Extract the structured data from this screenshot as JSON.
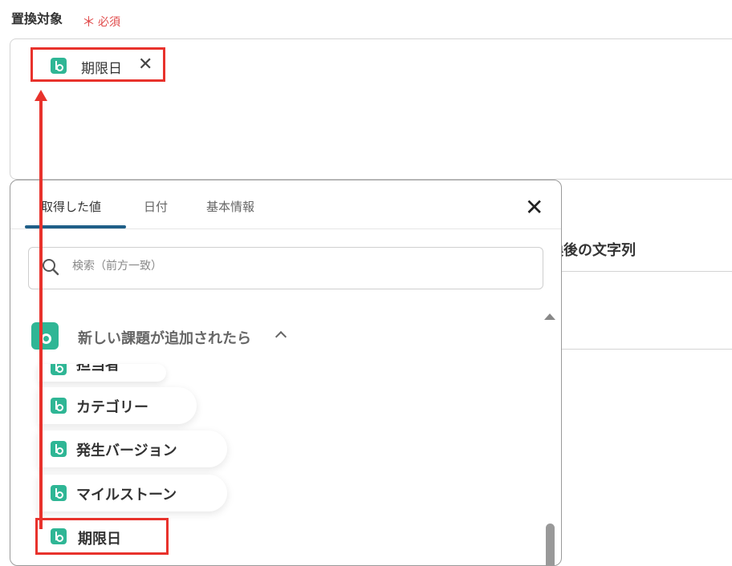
{
  "field": {
    "label": "置換対象",
    "required_star": "＊",
    "required_text": "必須"
  },
  "selected_chip": {
    "label": "期限日",
    "icon": "backlog-icon"
  },
  "background": {
    "field_label_partial": "換後の文字列"
  },
  "popup": {
    "tabs": [
      {
        "label": "取得した値",
        "active": true
      },
      {
        "label": "日付",
        "active": false
      },
      {
        "label": "基本情報",
        "active": false
      }
    ],
    "search_placeholder": "検索（前方一致）",
    "group": {
      "title": "新しい課題が追加されたら",
      "icon": "backlog-icon",
      "expanded": true
    },
    "items": [
      {
        "label": "担当者"
      },
      {
        "label": "カテゴリー"
      },
      {
        "label": "発生バージョン"
      },
      {
        "label": "マイルストーン"
      },
      {
        "label": "期限日"
      }
    ]
  },
  "colors": {
    "app_icon": "#2fb695",
    "highlight_border": "#e8322c",
    "required": "#e04a4a",
    "tab_underline": "#1f5f88"
  }
}
